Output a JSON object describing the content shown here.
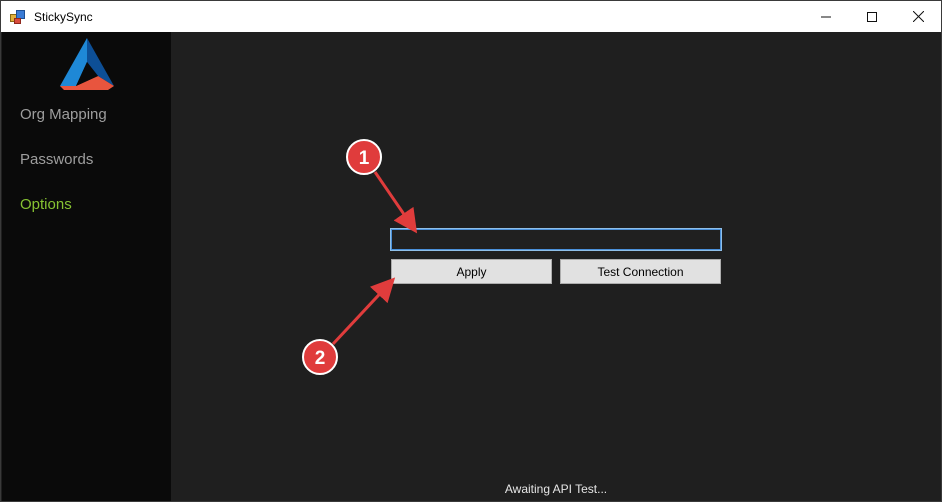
{
  "window": {
    "title": "StickySync",
    "icon": "app-icon",
    "controls": [
      "minimize-icon",
      "maximize-icon",
      "close-icon"
    ]
  },
  "sidebar": {
    "logo": "triangle-logo",
    "items": [
      {
        "label": "Org Mapping",
        "active": false
      },
      {
        "label": "Passwords",
        "active": false
      },
      {
        "label": "Options",
        "active": true
      }
    ]
  },
  "options": {
    "input_value": "",
    "apply_label": "Apply",
    "test_label": "Test Connection"
  },
  "status": {
    "text": "Awaiting API Test..."
  },
  "annotations": [
    {
      "number": "1"
    },
    {
      "number": "2"
    }
  ],
  "colors": {
    "accent": "#86c232",
    "background": "#1f1f1f",
    "sidebar": "#0a0a0a",
    "annotation": "#e03c3c"
  }
}
